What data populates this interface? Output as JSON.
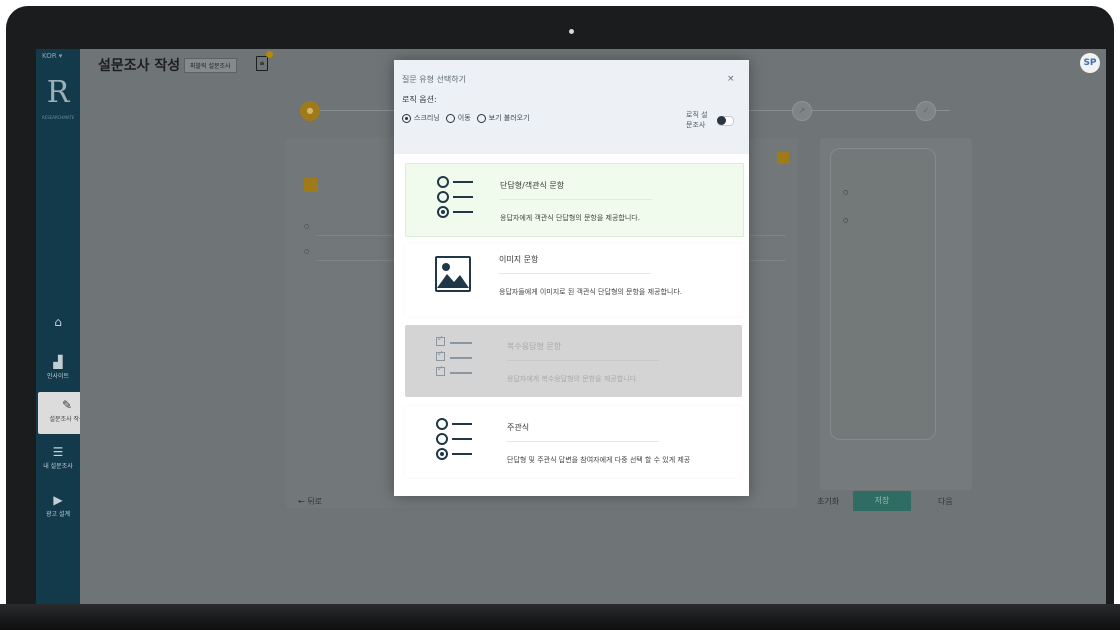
{
  "app": {
    "language": "KOR ▾",
    "logo_letter": "R",
    "logo_sub": "RESEARCHMATE"
  },
  "sidebar": {
    "items": [
      {
        "label": "",
        "icon": "home-icon"
      },
      {
        "label": "인사이트",
        "icon": "chart-icon"
      },
      {
        "label": "설문조사 작성",
        "icon": "pencil-icon"
      },
      {
        "label": "내 설문조사",
        "icon": "list-icon"
      },
      {
        "label": "광고 설계",
        "icon": "video-icon"
      }
    ]
  },
  "header": {
    "title": "설문조사 작성",
    "badge": "퍼블릭 설문조사",
    "avatar": "SP"
  },
  "modal": {
    "title": "질문 유형 선택하기",
    "close": "×",
    "logic_label": "로직 옵션:",
    "radio_options": [
      {
        "label": "스크리닝",
        "selected": true
      },
      {
        "label": "이동",
        "selected": false
      },
      {
        "label": "보기 불러오기",
        "selected": false
      }
    ],
    "logic_survey_label": "로직 설문조사",
    "logic_survey_enabled": true,
    "question_types": [
      {
        "name": "단답형/객관식 문항",
        "desc": "응답자에게 객관식 단답형의 문항을 제공합니다.",
        "state": "highlight",
        "icon": "radio-list-icon"
      },
      {
        "name": "이미지 문항",
        "desc": "응답자들에게 이미지로 된 객관식 단답형의 문항을 제공합니다.",
        "state": "plain",
        "icon": "image-icon"
      },
      {
        "name": "복수응답형 문항",
        "desc": "응답자에게 복수응답형의 문항을 제공합니다.",
        "state": "disabled",
        "icon": "checkbox-list-icon"
      },
      {
        "name": "주관식",
        "desc": "단답형 및 주관식 답변을 참여자에게 다중 선택 할 수 있게 제공",
        "state": "plain",
        "icon": "radio-list-icon"
      }
    ]
  },
  "editor": {
    "row_labels": [
      "",
      ""
    ],
    "phone_options": [
      "",
      ""
    ],
    "back_label": "← 뒤로",
    "reset_label": "초기화",
    "save_label": "저장",
    "next_label": "다음"
  },
  "colors": {
    "sidebar": "#123a4a",
    "overlay": "#6f7577",
    "highlight_bg": "#f0fbee",
    "disabled_bg": "#d4d4d4",
    "accent": "#1f3747",
    "save_button": "#2f6c63"
  }
}
